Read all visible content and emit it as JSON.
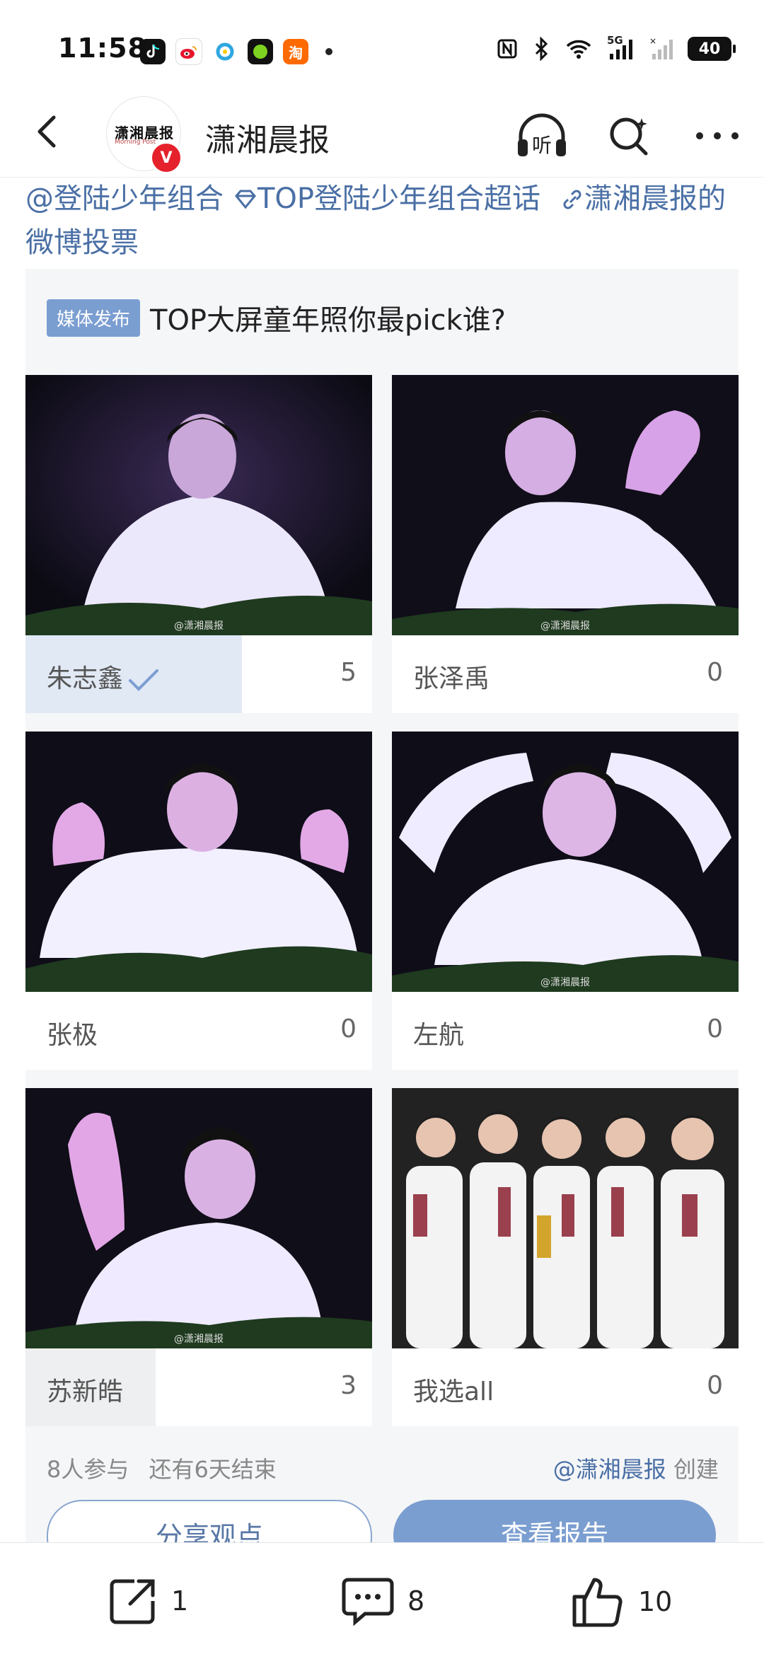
{
  "status_bar": {
    "time": "11:58",
    "apps": [
      "tiktok-icon",
      "weibo-icon",
      "qq-browser-icon",
      "green-app-icon",
      "taobao-icon"
    ],
    "taobao_label": "淘",
    "network": "5G",
    "battery": "40"
  },
  "header": {
    "account_name": "潇湘晨报",
    "avatar_text": "潇湘晨报",
    "avatar_sub": "Morning Post",
    "verified": "V",
    "listen_label": "听"
  },
  "topics": {
    "mention": "@登陆少年组合",
    "supertopic": "TOP登陆少年组合超话",
    "link": "潇湘晨报的微博投票"
  },
  "vote": {
    "badge": "媒体发布",
    "title": "TOP大屏童年照你最pick谁?",
    "watermark": "@潇湘晨报",
    "options": [
      {
        "label": "朱志鑫",
        "count": "5",
        "selected": true,
        "share": 0.625
      },
      {
        "label": "张泽禹",
        "count": "0",
        "selected": false,
        "share": 0
      },
      {
        "label": "张极",
        "count": "0",
        "selected": false,
        "share": 0
      },
      {
        "label": "左航",
        "count": "0",
        "selected": false,
        "share": 0
      },
      {
        "label": "苏新皓",
        "count": "3",
        "selected": false,
        "share": 0.375
      },
      {
        "label": "我选all",
        "count": "0",
        "selected": false,
        "share": 0
      }
    ],
    "participants": "8人参与",
    "remaining": "还有6天结束",
    "creator": "@潇湘晨报",
    "creator_suffix": "创建",
    "share_button": "分享观点",
    "report_button": "查看报告"
  },
  "bottom_bar": {
    "repost_count": "1",
    "comment_count": "8",
    "like_count": "10"
  },
  "colors": {
    "link": "#4a6fa5",
    "accent": "#7b9ed1",
    "selected_fill": "#e1e9f5",
    "neutral_fill": "#eeeff1",
    "verified_red": "#e5212b"
  }
}
